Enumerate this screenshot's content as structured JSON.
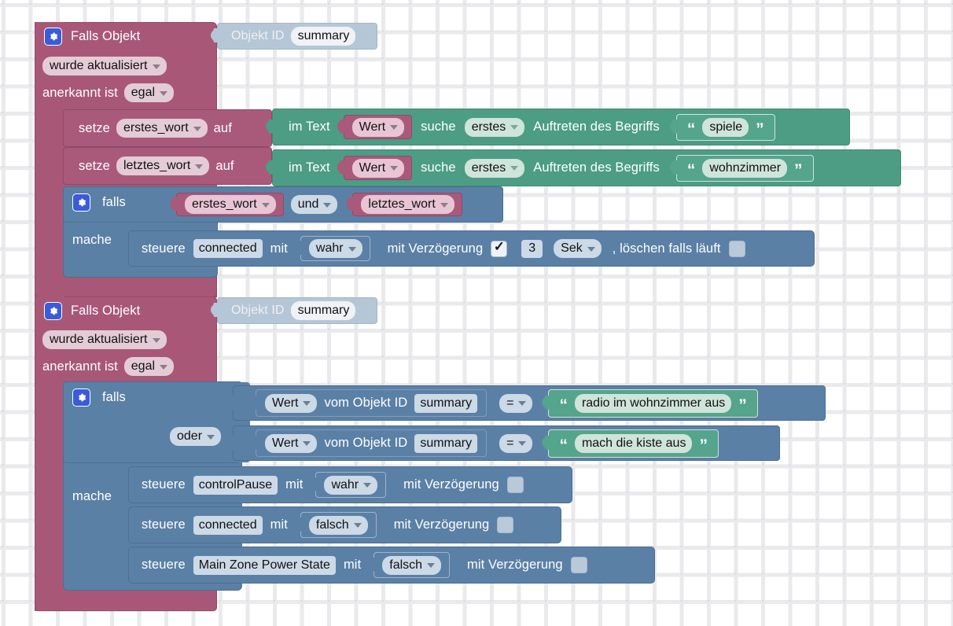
{
  "app": {
    "name": "blockly-workspace",
    "language": "de"
  },
  "colors": {
    "event_pink": "#a85876",
    "set_pink": "#a95a7a",
    "control_blue": "#5b80a6",
    "text_green": "#4c9d84",
    "objectid_gray": "#b5c7d6",
    "gear_blue": "#3b5bdb",
    "canvas_bg": "#ffffff",
    "grid_dot": "#d9d9dd"
  },
  "scripts": [
    {
      "id": "script-1",
      "header": {
        "gear_icon": "gear-icon",
        "title": "Falls Objekt",
        "object_id_label": "Objekt ID",
        "object_id_value": "summary",
        "trigger_dropdown": "wurde aktualisiert",
        "ack_label": "anerkannt ist",
        "ack_dropdown": "egal"
      },
      "body": [
        {
          "kind": "set-variable",
          "set_label": "setze",
          "variable": "erstes_wort",
          "to_label": "auf",
          "value": {
            "kind": "text-index-of",
            "in_text_label": "im Text",
            "operand": "Wert",
            "search_label": "suche",
            "occurrence": "erstes",
            "of_label": "Auftreten des Begriffs",
            "term": "spiele"
          }
        },
        {
          "kind": "set-variable",
          "set_label": "setze",
          "variable": "letztes_wort",
          "to_label": "auf",
          "value": {
            "kind": "text-index-of",
            "in_text_label": "im Text",
            "operand": "Wert",
            "search_label": "suche",
            "occurrence": "erstes",
            "of_label": "Auftreten des Begriffs",
            "term": "wohnzimmer"
          }
        },
        {
          "kind": "if-do",
          "gear_icon": "gear-icon",
          "if_label": "falls",
          "do_label": "mache",
          "condition": {
            "kind": "logic-operation",
            "left": "erstes_wort",
            "operator": "und",
            "right": "letztes_wort"
          },
          "statements": [
            {
              "kind": "control-state",
              "control_label": "steuere",
              "object": "connected",
              "with_label": "mit",
              "value": "wahr",
              "delay_label": "mit Verzögerung",
              "delay_checked": true,
              "delay_amount": "3",
              "delay_unit": "Sek",
              "clear_label": ", löschen falls läuft",
              "clear_checked": false
            }
          ]
        }
      ]
    },
    {
      "id": "script-2",
      "header": {
        "gear_icon": "gear-icon",
        "title": "Falls Objekt",
        "object_id_label": "Objekt ID",
        "object_id_value": "summary",
        "trigger_dropdown": "wurde aktualisiert",
        "ack_label": "anerkannt ist",
        "ack_dropdown": "egal"
      },
      "body": [
        {
          "kind": "if-do",
          "gear_icon": "gear-icon",
          "if_label": "falls",
          "do_label": "mache",
          "condition": {
            "kind": "logic-operation",
            "operator": "oder",
            "comparisons": [
              {
                "operand": "Wert",
                "from_label": "vom Objekt ID",
                "object_id": "summary",
                "comparator": "=",
                "text": "radio im wohnzimmer aus"
              },
              {
                "operand": "Wert",
                "from_label": "vom Objekt ID",
                "object_id": "summary",
                "comparator": "=",
                "text": "mach die kiste aus"
              }
            ]
          },
          "statements": [
            {
              "kind": "control-state",
              "control_label": "steuere",
              "object": "controlPause",
              "with_label": "mit",
              "value": "wahr",
              "delay_label": "mit Verzögerung",
              "delay_checked": false
            },
            {
              "kind": "control-state",
              "control_label": "steuere",
              "object": "connected",
              "with_label": "mit",
              "value": "falsch",
              "delay_label": "mit Verzögerung",
              "delay_checked": false
            },
            {
              "kind": "control-state",
              "control_label": "steuere",
              "object": "Main Zone Power State",
              "with_label": "mit",
              "value": "falsch",
              "delay_label": "mit Verzögerung",
              "delay_checked": false
            }
          ]
        }
      ]
    }
  ]
}
